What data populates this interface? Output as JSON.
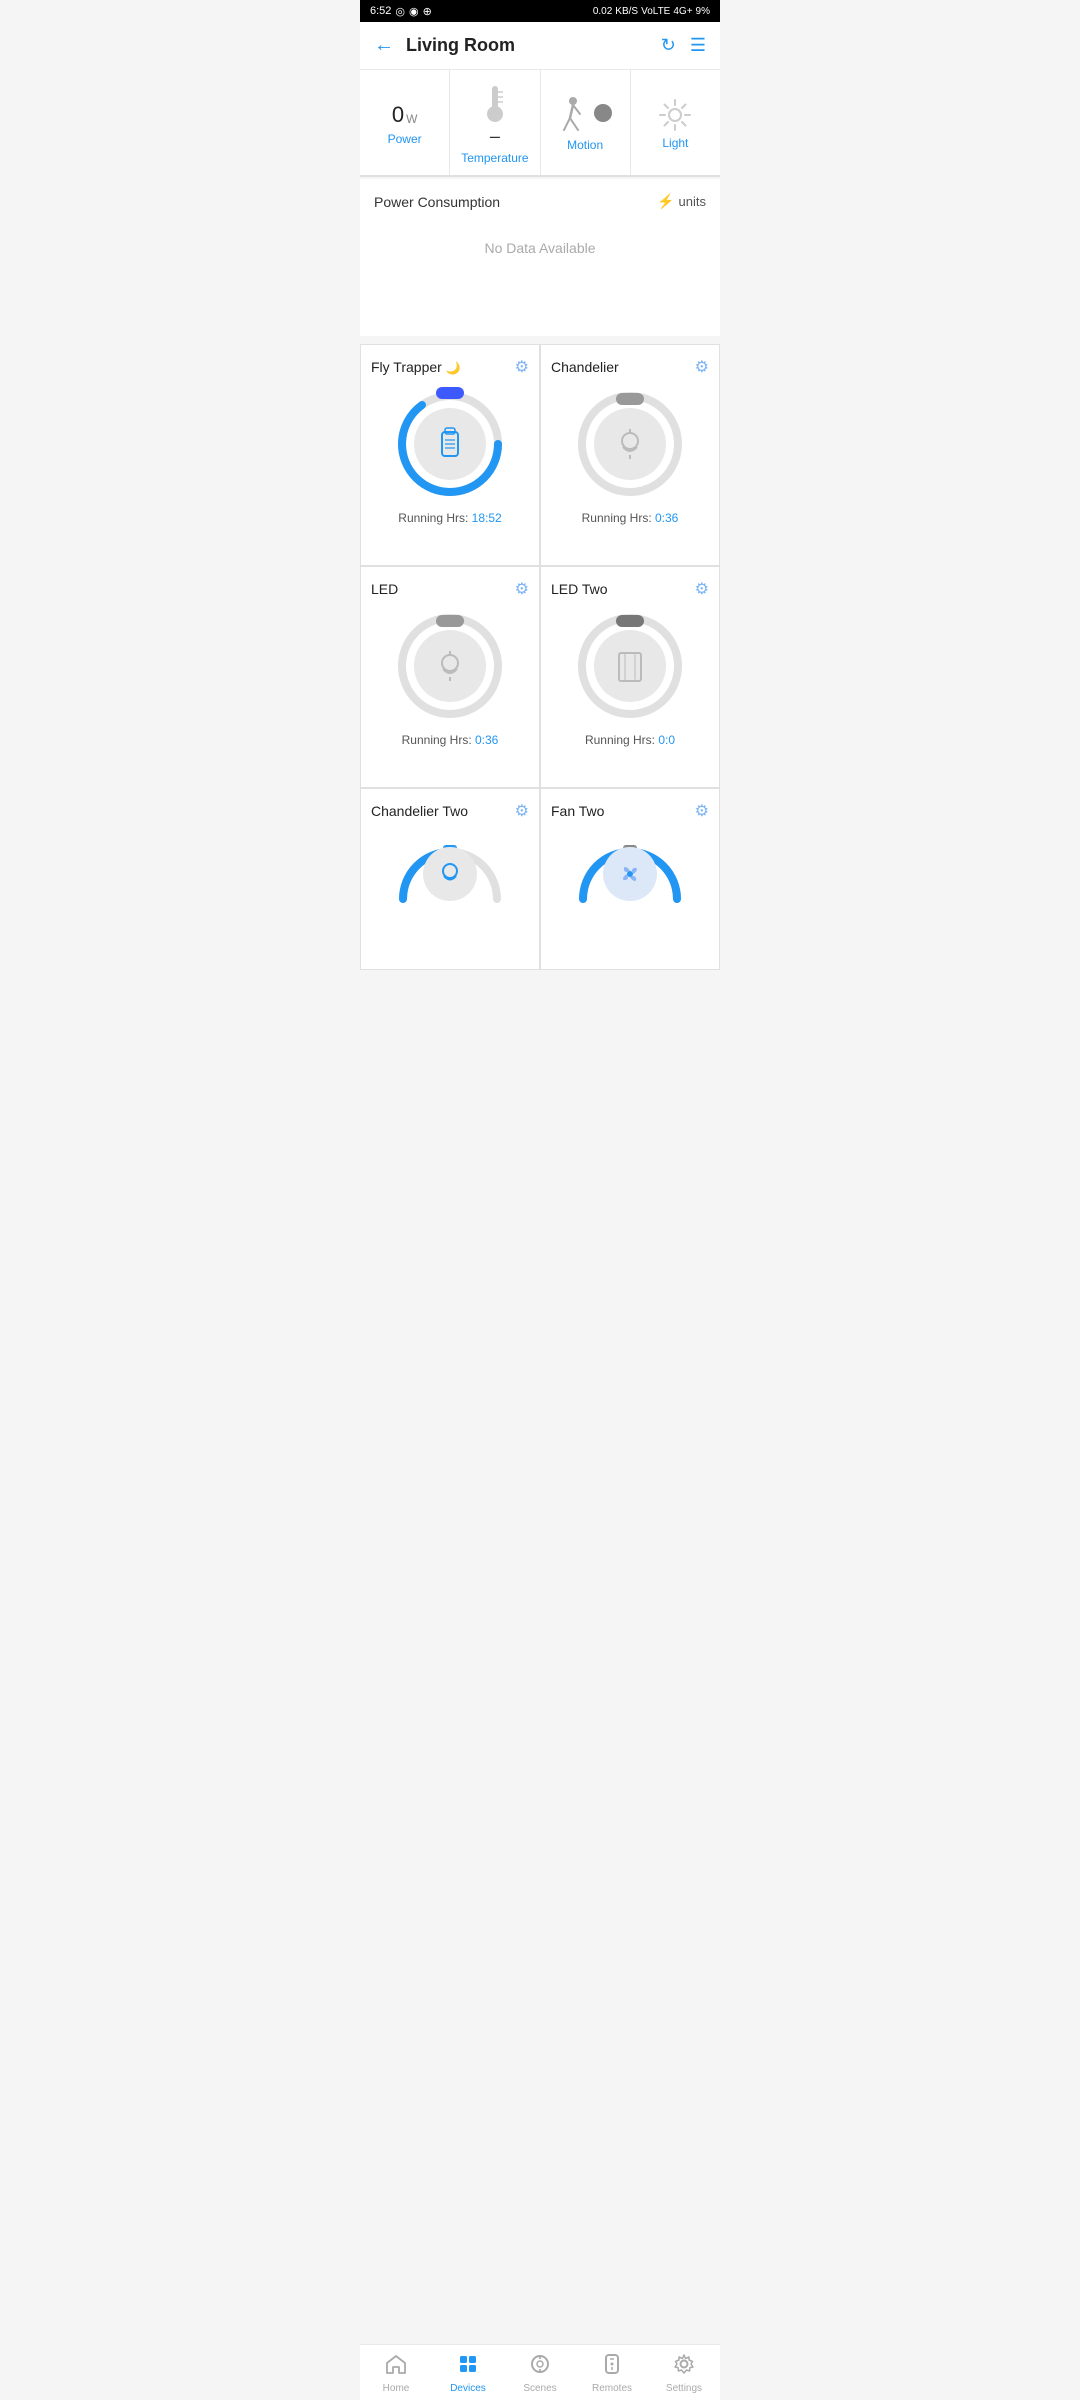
{
  "statusBar": {
    "time": "6:52",
    "speed": "0.02",
    "speedUnit": "KB/S",
    "network": "VoLTE",
    "signal": "4G+",
    "battery": "9%"
  },
  "header": {
    "title": "Living Room",
    "backLabel": "←",
    "refreshLabel": "↻",
    "menuLabel": "≡"
  },
  "sensors": [
    {
      "id": "power",
      "value": "0",
      "unit": "W",
      "label": "Power",
      "type": "value"
    },
    {
      "id": "temperature",
      "value": "–",
      "label": "Temperature",
      "type": "thermo"
    },
    {
      "id": "motion",
      "label": "Motion",
      "type": "motion"
    },
    {
      "id": "light",
      "label": "Light",
      "type": "light"
    }
  ],
  "powerSection": {
    "title": "Power Consumption",
    "unitsLabel": "units",
    "noData": "No Data Available"
  },
  "devices": [
    {
      "id": "fly-trapper",
      "name": "Fly Trapper",
      "hasMoon": true,
      "icon": "🧴",
      "iconType": "bottle",
      "toggleState": "on",
      "progressDeg": 270,
      "runningHrs": "18:52",
      "type": "full"
    },
    {
      "id": "chandelier",
      "name": "Chandelier",
      "hasMoon": false,
      "icon": "💡",
      "iconType": "bulb",
      "toggleState": "off",
      "progressDeg": 60,
      "runningHrs": "0:36",
      "type": "full"
    },
    {
      "id": "led",
      "name": "LED",
      "hasMoon": false,
      "icon": "💡",
      "iconType": "bulb",
      "toggleState": "off",
      "progressDeg": 60,
      "runningHrs": "0:36",
      "type": "full"
    },
    {
      "id": "led-two",
      "name": "LED Two",
      "hasMoon": false,
      "icon": "📱",
      "iconType": "tablet",
      "toggleState": "off-dark",
      "progressDeg": 0,
      "runningHrs": "0:0",
      "type": "full"
    },
    {
      "id": "chandelier-two",
      "name": "Chandelier Two",
      "hasMoon": false,
      "icon": "💡",
      "iconType": "bulb-blue",
      "toggleState": "on-blue",
      "progressDeg": 0,
      "runningHrs": "",
      "type": "half"
    },
    {
      "id": "fan-two",
      "name": "Fan Two",
      "hasMoon": false,
      "icon": "🌀",
      "iconType": "fan",
      "toggleState": "on",
      "progressDeg": 180,
      "runningHrs": "",
      "type": "half"
    }
  ],
  "bottomNav": [
    {
      "id": "home",
      "label": "Home",
      "icon": "🏠",
      "active": false
    },
    {
      "id": "devices",
      "label": "Devices",
      "icon": "📦",
      "active": true
    },
    {
      "id": "scenes",
      "label": "Scenes",
      "icon": "⏰",
      "active": false
    },
    {
      "id": "remotes",
      "label": "Remotes",
      "icon": "🖥",
      "active": false
    },
    {
      "id": "settings",
      "label": "Settings",
      "icon": "⚙️",
      "active": false
    }
  ]
}
